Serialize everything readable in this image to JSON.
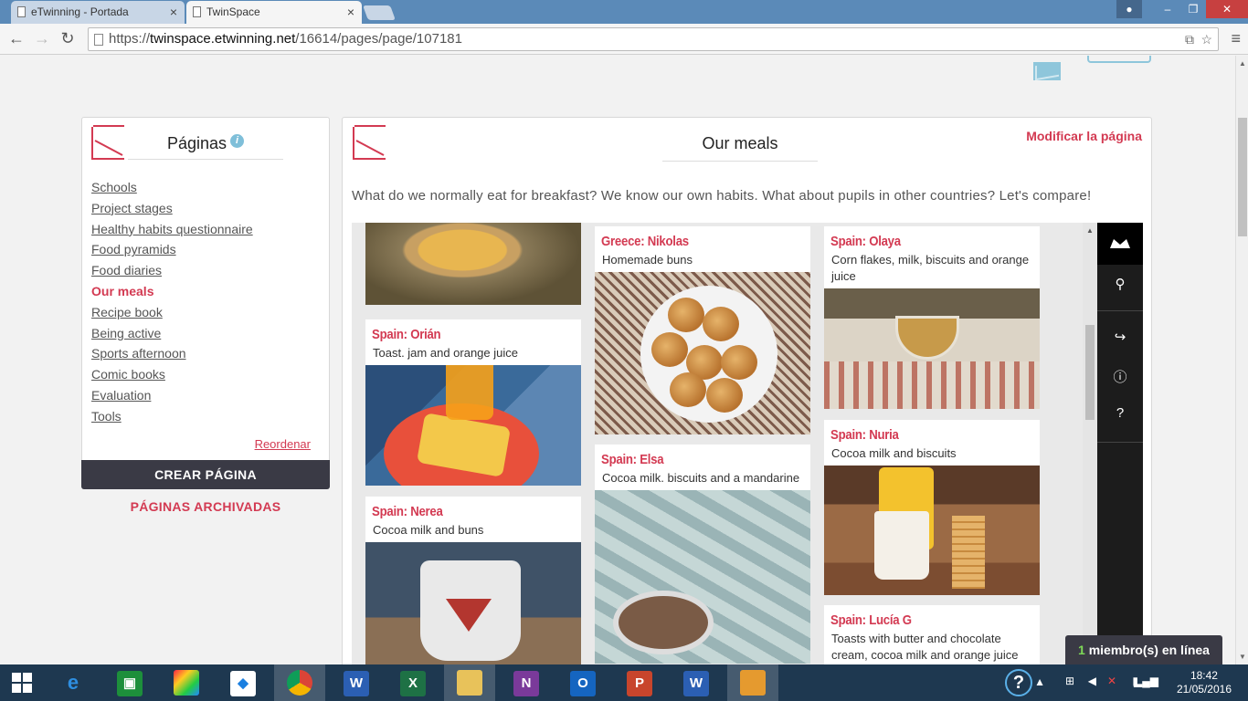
{
  "browser": {
    "tabs": [
      {
        "title": "eTwinning - Portada"
      },
      {
        "title": "TwinSpace"
      }
    ],
    "url_prefix": "https://",
    "url_host": "twinspace.etwinning.net",
    "url_path": "/16614/pages/page/107181"
  },
  "sidebar": {
    "title": "Páginas",
    "info_glyph": "i",
    "items": [
      {
        "label": "Schools"
      },
      {
        "label": "Project stages"
      },
      {
        "label": "Healthy habits questionnaire"
      },
      {
        "label": "Food pyramids"
      },
      {
        "label": "Food diaries"
      },
      {
        "label": "Our meals"
      },
      {
        "label": "Recipe book"
      },
      {
        "label": "Being active"
      },
      {
        "label": "Sports afternoon"
      },
      {
        "label": "Comic books"
      },
      {
        "label": "Evaluation"
      },
      {
        "label": "Tools"
      }
    ],
    "current_item": "Our meals",
    "reorder_label": "Reordenar",
    "create_label": "CREAR PÁGINA",
    "archived_label": "PÁGINAS ARCHIVADAS"
  },
  "main": {
    "title": "Our meals",
    "edit_label": "Modificar la página",
    "intro": "What do we normally eat for breakfast? We know our own habits. What about pupils in other countries? Let's compare!"
  },
  "padlet": {
    "posts": [
      {
        "title": "Spain: Orián",
        "desc": "Toast. jam and orange juice"
      },
      {
        "title": "Spain: Nerea",
        "desc": "Cocoa milk and buns"
      },
      {
        "title": "Greece: Nikolas",
        "desc": "Homemade buns"
      },
      {
        "title": "Spain: Elsa",
        "desc": "Cocoa milk. biscuits and a mandarine"
      },
      {
        "title": "Spain: Olaya",
        "desc": "Corn flakes, milk, biscuits and orange juice"
      },
      {
        "title": "Spain: Nuria",
        "desc": "Cocoa milk and biscuits"
      },
      {
        "title": "Spain: Lucía G",
        "desc": "Toasts with butter and chocolate cream, cocoa milk and orange juice"
      }
    ],
    "sidebar_icons": [
      "crown-icon",
      "key-icon",
      "share-icon",
      "info-icon",
      "help-icon"
    ]
  },
  "online": {
    "count": "1",
    "label": " miembro(s) en línea"
  },
  "taskbar": {
    "time": "18:42",
    "date": "21/05/2016"
  },
  "colors": {
    "accent": "#d33a52",
    "dark": "#3a3a45",
    "titlebar": "#5b8ab8"
  }
}
